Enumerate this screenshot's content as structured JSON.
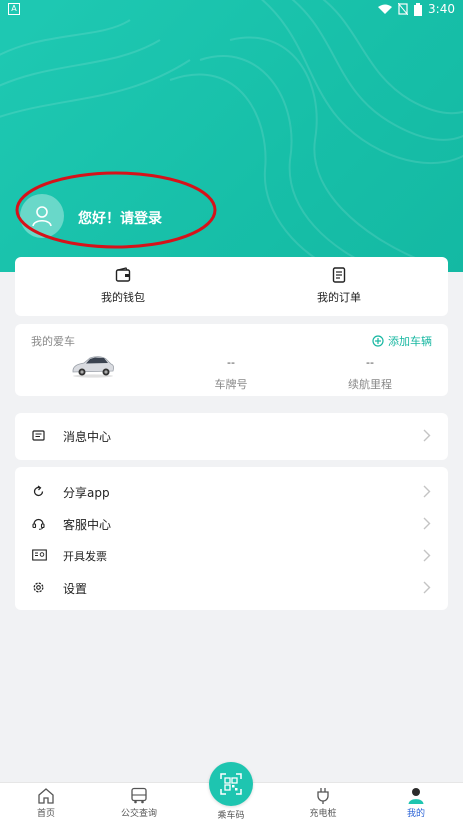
{
  "status": {
    "time": "3:40"
  },
  "user": {
    "greeting": "您好！请登录"
  },
  "quick": {
    "wallet": "我的钱包",
    "orders": "我的订单"
  },
  "car": {
    "section_title": "我的爱车",
    "add_label": "添加车辆",
    "plate_value": "--",
    "plate_label": "车牌号",
    "range_value": "--",
    "range_label": "续航里程"
  },
  "menu_single": {
    "messages": "消息中心"
  },
  "menu": {
    "share": "分享app",
    "service": "客服中心",
    "invoice": "开具发票",
    "settings": "设置"
  },
  "tabs": {
    "home": "首页",
    "bus": "公交查询",
    "ride_code": "乘车码",
    "charging": "充电桩",
    "mine": "我的"
  },
  "colors": {
    "teal": "#1ec5b0",
    "active_tab": "#2a62d6",
    "highlight": "#d6121a"
  }
}
